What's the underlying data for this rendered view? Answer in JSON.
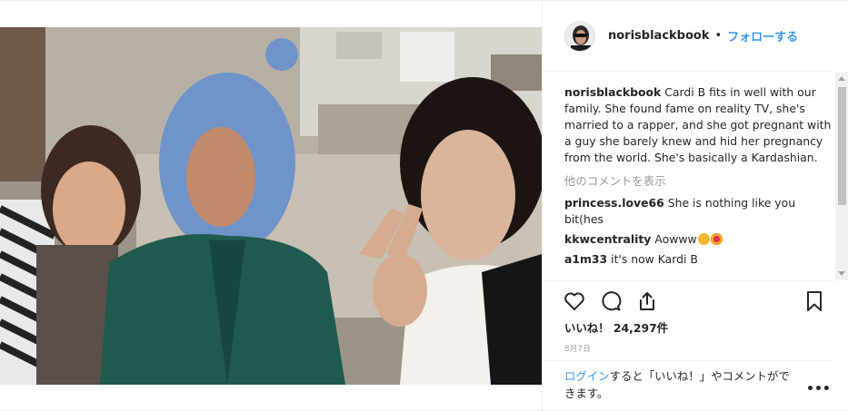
{
  "header": {
    "username": "norisblackbook",
    "separator": "•",
    "follow_label": "フォローする"
  },
  "caption": {
    "username": "norisblackbook",
    "text": "Cardi B fits in well with our family. She found fame on reality TV, she's married to a rapper, and she got pregnant with a guy she barely knew and hid her pregnancy from the world. She's basically a Kardashian."
  },
  "more_comments_label": "他のコメントを表示",
  "comments": [
    {
      "username": "princess.love66",
      "text": "She is nothing like you bit(hes"
    },
    {
      "username": "kkwcentrality",
      "text": "Aowww"
    },
    {
      "username": "a1m33",
      "text": "it's now Kardi B"
    }
  ],
  "likes": {
    "label": "いいね！",
    "count": "24,297件"
  },
  "date": "8月7日",
  "login_prompt": {
    "link": "ログイン",
    "text": "すると「いいね！」やコメントができます。"
  },
  "more_options": "•••",
  "icons": {
    "like": "heart-icon",
    "comment": "comment-icon",
    "share": "share-icon",
    "save": "bookmark-icon"
  },
  "colors": {
    "link": "#3897f0",
    "muted": "#999999",
    "text": "#262626",
    "border": "#efefef"
  }
}
